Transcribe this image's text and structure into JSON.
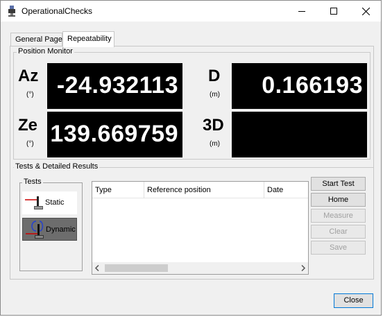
{
  "window": {
    "title": "OperationalChecks"
  },
  "tabs": [
    {
      "label": "General Page",
      "active": false
    },
    {
      "label": "Repeatability",
      "active": true
    }
  ],
  "position_monitor": {
    "label": "Position Monitor",
    "az": {
      "label": "Az",
      "unit": "(°)",
      "value": "-24.932113"
    },
    "ze": {
      "label": "Ze",
      "unit": "(°)",
      "value": "139.669759"
    },
    "d": {
      "label": "D",
      "unit": "(m)",
      "value": "0.166193"
    },
    "d3": {
      "label": "3D",
      "unit": "(m)",
      "value": ""
    }
  },
  "tests_section": {
    "label": "Tests & Detailed Results",
    "tests_group_label": "Tests",
    "tests": [
      {
        "label": "Static",
        "icon": "static-test-icon",
        "selected": false
      },
      {
        "label": "Dynamic",
        "icon": "dynamic-test-icon",
        "selected": true
      }
    ],
    "table": {
      "columns": [
        "Type",
        "Reference position",
        "Date"
      ],
      "rows": []
    },
    "actions": [
      {
        "label": "Start Test",
        "enabled": true
      },
      {
        "label": "Home",
        "enabled": true
      },
      {
        "label": "Measure",
        "enabled": false
      },
      {
        "label": "Clear",
        "enabled": false
      },
      {
        "label": "Save",
        "enabled": false
      }
    ]
  },
  "footer": {
    "close_label": "Close"
  },
  "colors": {
    "display_bg": "#000000",
    "display_fg": "#ffffff",
    "focus_border": "#0078d7",
    "selected_test_bg": "#6d6d6d"
  }
}
